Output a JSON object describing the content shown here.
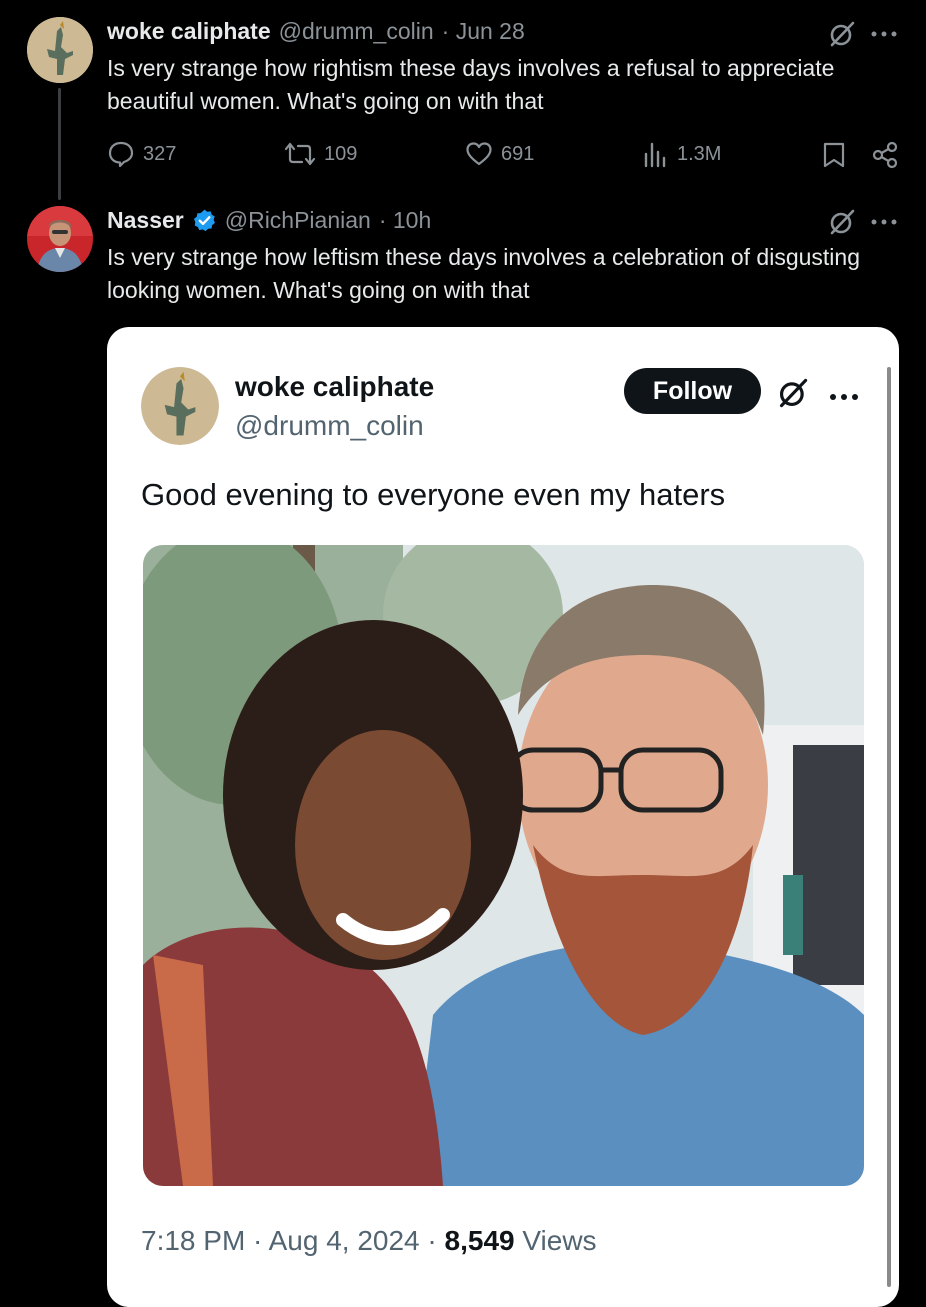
{
  "post1": {
    "name": "woke caliphate",
    "handle": "@drumm_colin",
    "date": "· Jun 28",
    "text_line1": "Is very strange how rightism these days involves a refusal to appreciate",
    "text_line2": "beautiful women. What's going on with that",
    "replies": "327",
    "reposts": "109",
    "likes": "691",
    "views": "1.3M"
  },
  "post2": {
    "name": "Nasser",
    "handle": "@RichPianian",
    "date": "· 10h",
    "text_line1": "Is very strange how leftism these days involves a celebration of disgusting",
    "text_line2": "looking women. What's going on with that"
  },
  "embedded": {
    "name": "woke caliphate",
    "handle": "@drumm_colin",
    "follow_label": "Follow",
    "text": "Good evening to everyone even my haters",
    "time": "7:18 PM · Aug 4, 2024 · ",
    "views_count": "8,549",
    "views_label": " Views"
  },
  "icons": {
    "grok": "grok-slash-icon",
    "more": "more-dots-icon",
    "reply": "reply-bubble-icon",
    "repost": "repost-arrows-icon",
    "like": "heart-icon",
    "views": "bar-chart-icon",
    "bookmark": "bookmark-icon",
    "share": "share-icon",
    "verified": "verified-badge-icon"
  },
  "colors": {
    "background": "#000000",
    "text": "#e7e9ea",
    "muted": "#8b9298",
    "verified": "#1d9bf0",
    "card": "#ffffff"
  }
}
